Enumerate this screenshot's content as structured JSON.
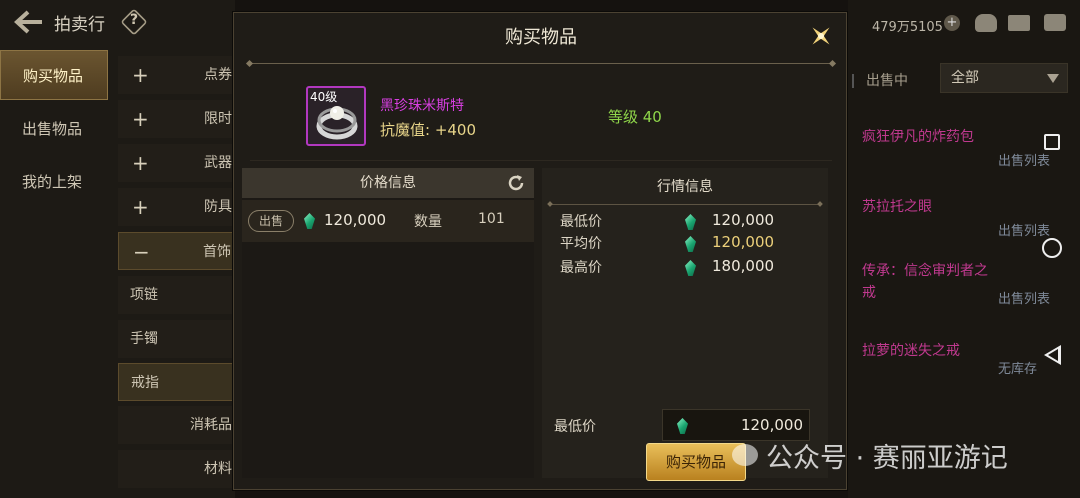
{
  "topbar": {
    "title": "拍卖行",
    "help": "?"
  },
  "nav": [
    {
      "label": "购买物品",
      "active": true
    },
    {
      "label": "出售物品",
      "active": false
    },
    {
      "label": "我的上架",
      "active": false
    }
  ],
  "categories": [
    {
      "label": "点券",
      "type": "plus"
    },
    {
      "label": "限时",
      "type": "plus"
    },
    {
      "label": "武器",
      "type": "plus"
    },
    {
      "label": "防具",
      "type": "plus"
    },
    {
      "label": "首饰",
      "type": "minus"
    },
    {
      "label": "项链",
      "type": "sub"
    },
    {
      "label": "手镯",
      "type": "sub"
    },
    {
      "label": "戒指",
      "type": "sub"
    },
    {
      "label": "消耗品",
      "type": "none"
    },
    {
      "label": "材料",
      "type": "none"
    }
  ],
  "header_right": {
    "currency": "479万5105",
    "plus": "+"
  },
  "filter": {
    "on_sale": "出售中",
    "selected": "全部"
  },
  "listings": [
    {
      "name": "疯狂伊凡的炸药包",
      "sub": "出售列表"
    },
    {
      "name": "苏拉托之眼",
      "sub": "出售列表"
    },
    {
      "name": "传承：信念审判者之戒",
      "sub": "出售列表"
    },
    {
      "name": "拉萝的迷失之戒",
      "sub": "无库存"
    }
  ],
  "dialog": {
    "title": "购买物品",
    "item": {
      "level_tag": "40级",
      "name": "黑珍珠米斯特",
      "stat": "抗魔值: +400",
      "grade": "等级 40",
      "border_color": "#b238c0"
    },
    "price_panel": {
      "title": "价格信息",
      "order": {
        "tag": "出售",
        "price": "120,000",
        "qty_label": "数量",
        "qty": "101"
      }
    },
    "market_panel": {
      "title": "行情信息",
      "rows": [
        {
          "label": "最低价",
          "value": "120,000"
        },
        {
          "label": "平均价",
          "value": "120,000"
        },
        {
          "label": "最高价",
          "value": "180,000"
        }
      ],
      "min_label": "最低价",
      "min_value": "120,000"
    },
    "buy_button": "购买物品"
  },
  "watermark": "公众号 · 赛丽亚游记",
  "colors": {
    "accent_gold": "#e9bf5a",
    "rare_purple": "#d73fe0",
    "grade_green": "#8fd64a",
    "gem_green": "#1aa570"
  }
}
